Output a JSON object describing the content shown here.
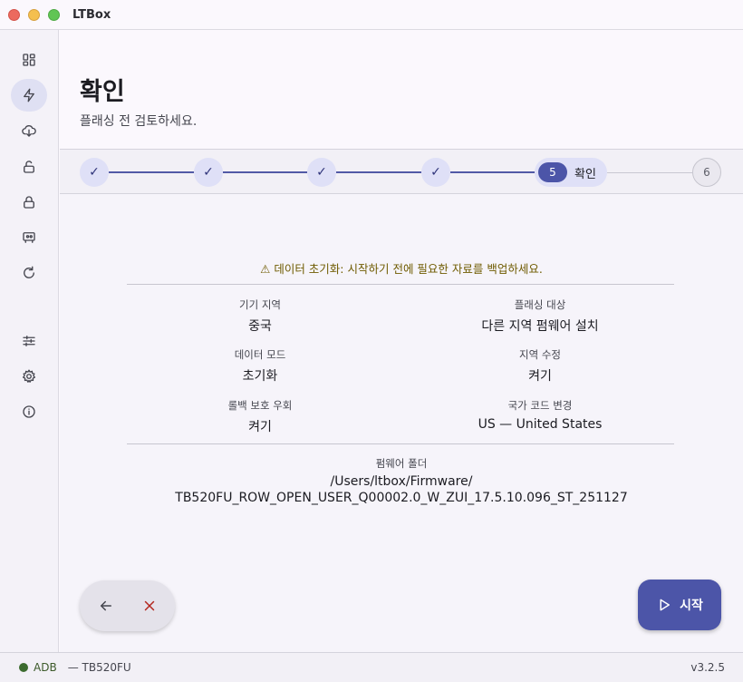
{
  "window": {
    "title": "LTBox"
  },
  "sidebar": {
    "items": [
      {
        "icon": "dashboard-icon"
      },
      {
        "icon": "flash-icon",
        "active": true
      },
      {
        "icon": "cloud-download-icon"
      },
      {
        "icon": "unlock-icon"
      },
      {
        "icon": "lock-icon"
      },
      {
        "icon": "device-icon"
      },
      {
        "icon": "refresh-icon"
      },
      {
        "icon": "sliders-icon"
      },
      {
        "icon": "gear-icon"
      },
      {
        "icon": "info-icon"
      }
    ]
  },
  "header": {
    "title": "확인",
    "subtitle": "플래싱 전 검토하세요."
  },
  "stepper": {
    "completed_mark": "✓",
    "current": {
      "number": "5",
      "label": "확인"
    },
    "next": {
      "number": "6"
    }
  },
  "review": {
    "warning": "⚠ 데이터 초기화: 시작하기 전에 필요한 자료를 백업하세요.",
    "fields": [
      {
        "label": "기기 지역",
        "value": "중국"
      },
      {
        "label": "플래싱 대상",
        "value": "다른 지역 펌웨어 설치"
      },
      {
        "label": "데이터 모드",
        "value": "초기화"
      },
      {
        "label": "지역 수정",
        "value": "켜기"
      },
      {
        "label": "롤백 보호 우회",
        "value": "켜기"
      },
      {
        "label": "국가 코드 변경",
        "value": "US — United States"
      }
    ],
    "folder_label": "펌웨어 폴더",
    "folder_path_line1": "/Users/ltbox/Firmware/",
    "folder_path_line2": "TB520FU_ROW_OPEN_USER_Q00002.0_W_ZUI_17.5.10.096_ST_251127"
  },
  "actions": {
    "start_label": "시작"
  },
  "status": {
    "connection": "ADB",
    "device": "— TB520FU",
    "version": "v3.2.5"
  },
  "colors": {
    "accent": "#4c55a8",
    "warning": "#6f5b00",
    "cancel": "#b3261e",
    "connected": "#3c6b2f"
  }
}
